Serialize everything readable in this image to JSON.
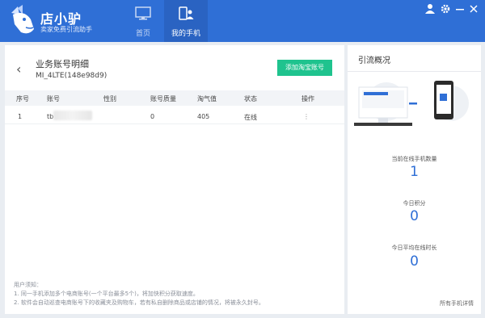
{
  "app": {
    "brand": "店小驴",
    "tagline": "卖家免费引流助手",
    "nav": [
      {
        "label": "首页",
        "icon": "monitor-icon"
      },
      {
        "label": "我的手机",
        "icon": "phone-user-icon"
      }
    ],
    "window_controls": [
      "user-icon",
      "gear-icon",
      "minimize-icon",
      "close-icon"
    ],
    "accent_color": "#2f6fd6",
    "button_color": "#1fc38e"
  },
  "detail": {
    "title": "业务账号明细",
    "device": "MI_4LTE(148e98d9)",
    "add_button": "添加淘宝账号",
    "columns": [
      "序号",
      "账号",
      "性别",
      "账号质量",
      "淘气值",
      "状态",
      "操作"
    ],
    "rows": [
      {
        "index": "1",
        "account": "tb",
        "gender": "",
        "quality": "0",
        "taoqi": "405",
        "status": "在线",
        "action": "⋮"
      }
    ],
    "notes_title": "用户须知：",
    "notes": [
      "1. 同一手机添加多个电商账号(一个平台最多5个)，将加快积分获取速度。",
      "2. 软件会自动巡查电商账号下的收藏夹及购物车，若有私自删除商品或店铺的情况，将被永久封号。"
    ]
  },
  "overview": {
    "title": "引流概况",
    "stats": [
      {
        "label": "当前在线手机数量",
        "value": "1"
      },
      {
        "label": "今日积分",
        "value": "0"
      },
      {
        "label": "今日平均在线时长",
        "value": "0"
      }
    ],
    "details_link": "所有手机详情"
  }
}
